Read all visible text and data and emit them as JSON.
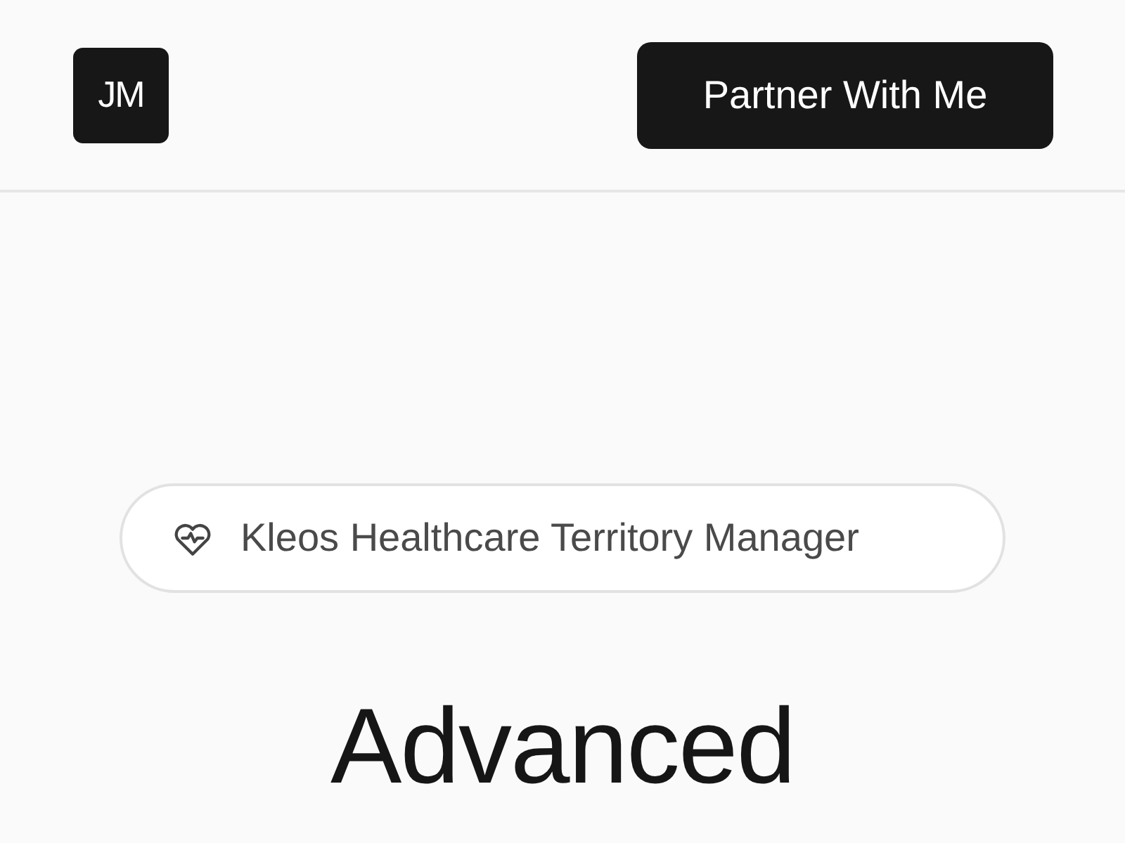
{
  "header": {
    "logo": "JM",
    "cta_button": "Partner With Me"
  },
  "hero": {
    "badge": "Kleos Healthcare Territory Manager",
    "heading": "Advanced"
  }
}
